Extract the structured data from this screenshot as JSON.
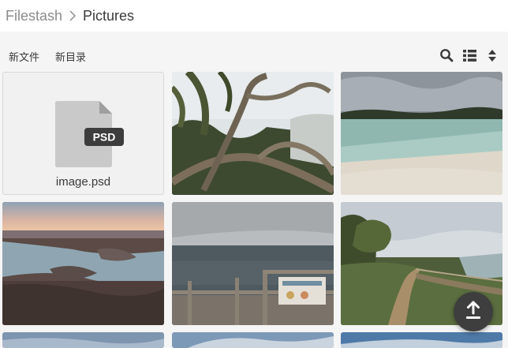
{
  "breadcrumb": {
    "root": "Filestash",
    "current": "Pictures"
  },
  "toolbar": {
    "new_file_label": "新文件",
    "new_dir_label": "新目录",
    "icons": [
      "search-icon",
      "list-view-icon",
      "sort-icon"
    ]
  },
  "files": [
    {
      "type": "file",
      "name": "image.psd",
      "badge": "PSD"
    },
    {
      "type": "image",
      "scene": "pandanus-tree"
    },
    {
      "type": "image",
      "scene": "lake-beach"
    },
    {
      "type": "image",
      "scene": "sunset-aerial-coast"
    },
    {
      "type": "image",
      "scene": "lookout-ocean"
    },
    {
      "type": "image",
      "scene": "coastal-boardwalk"
    },
    {
      "type": "image",
      "scene": "sky-partial"
    },
    {
      "type": "image",
      "scene": "sky-partial"
    },
    {
      "type": "image",
      "scene": "sky-partial"
    }
  ],
  "upload_button": {
    "icon": "upload-icon"
  },
  "colors": {
    "background": "#f5f5f5",
    "header": "#ffffff",
    "text": "#3a3a3a",
    "muted": "#8a8a8a",
    "fab": "#3e3e3e"
  }
}
